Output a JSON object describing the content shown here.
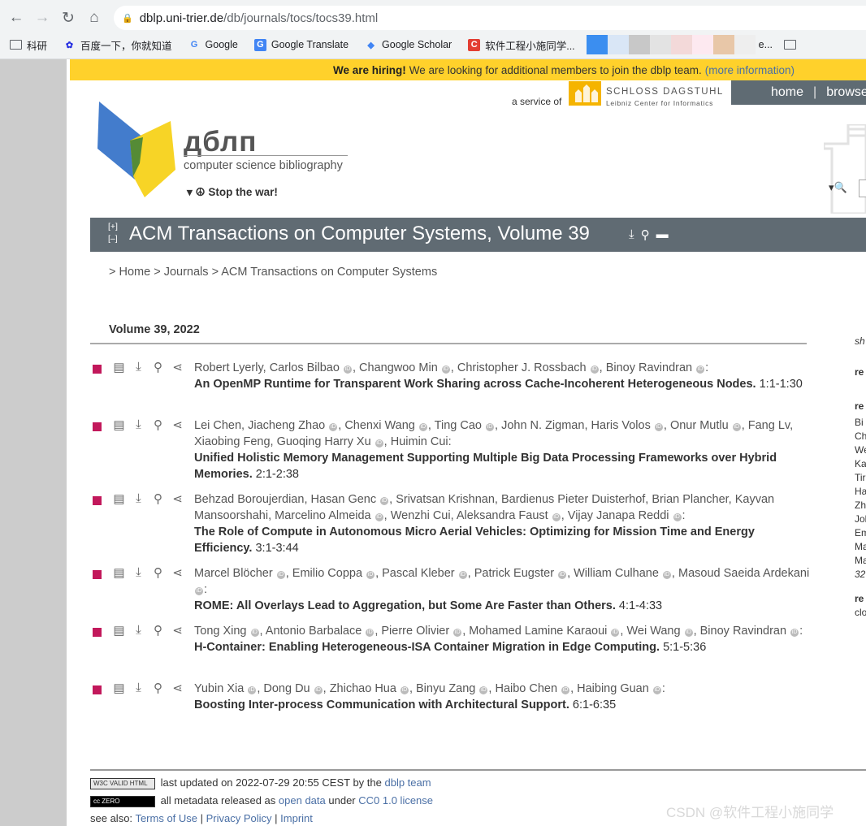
{
  "browser": {
    "url_host": "dblp.uni-trier.de",
    "url_path": "/db/journals/tocs/tocs39.html",
    "bookmarks": [
      "科研",
      "百度一下，你就知道",
      "Google",
      "Google Translate",
      "Google Scholar",
      "软件工程小施同学...",
      "e..."
    ]
  },
  "banner": {
    "bold": "We are hiring!",
    "text": "We are looking for additional members to join the dblp team.",
    "more": "(more information)"
  },
  "header": {
    "service_of": "a service of",
    "dagstuhl_name": "SCHLOSS DAGSTUHL",
    "dagstuhl_sub": "Leibniz Center for Informatics",
    "nav_home": "home",
    "nav_sep": "|",
    "nav_browse": "browse",
    "logo_text": "дблп",
    "logo_sub": "computer science bibliography",
    "stop_war": "Stop the war!"
  },
  "title_bar": {
    "toggle_plus": "[+]",
    "toggle_minus": "[–]",
    "title": "ACM Transactions on Computer Systems, Volume 39"
  },
  "breadcrumb": {
    "p1": ">",
    "home": "Home",
    "p2": ">",
    "journals": "Journals",
    "p3": ">",
    "venue": "ACM Transactions on Computer Systems"
  },
  "volume_heading": "Volume 39, 2022",
  "entries": [
    {
      "authors": [
        "Robert Lyerly",
        "Carlos Bilbao",
        "Changwoo Min",
        "Christopher J. Rossbach",
        "Binoy Ravindran"
      ],
      "title": "An OpenMP Runtime for Transparent Work Sharing across Cache-Incoherent Heterogeneous Nodes.",
      "pages": "1:1-1:30"
    },
    {
      "authors": [
        "Lei Chen",
        "Jiacheng Zhao",
        "Chenxi Wang",
        "Ting Cao",
        "John N. Zigman",
        "Haris Volos",
        "Onur Mutlu",
        "Fang Lv",
        "Xiaobing Feng",
        "Guoqing Harry Xu",
        "Huimin Cui"
      ],
      "title": "Unified Holistic Memory Management Supporting Multiple Big Data Processing Frameworks over Hybrid Memories.",
      "pages": "2:1-2:38"
    },
    {
      "authors": [
        "Behzad Boroujerdian",
        "Hasan Genc",
        "Srivatsan Krishnan",
        "Bardienus Pieter Duisterhof",
        "Brian Plancher",
        "Kayvan Mansoorshahi",
        "Marcelino Almeida",
        "Wenzhi Cui",
        "Aleksandra Faust",
        "Vijay Janapa Reddi"
      ],
      "title": "The Role of Compute in Autonomous Micro Aerial Vehicles: Optimizing for Mission Time and Energy Efficiency.",
      "pages": "3:1-3:44"
    },
    {
      "authors": [
        "Marcel Blöcher",
        "Emilio Coppa",
        "Pascal Kleber",
        "Patrick Eugster",
        "William Culhane",
        "Masoud Saeida Ardekani"
      ],
      "title": "ROME: All Overlays Lead to Aggregation, but Some Are Faster than Others.",
      "pages": "4:1-4:33"
    },
    {
      "authors": [
        "Tong Xing",
        "Antonio Barbalace",
        "Pierre Olivier",
        "Mohamed Lamine Karaoui",
        "Wei Wang",
        "Binoy Ravindran"
      ],
      "title": "H-Container: Enabling Heterogeneous-ISA Container Migration in Edge Computing.",
      "pages": "5:1-5:36"
    },
    {
      "authors": [
        "Yubin Xia",
        "Dong Du",
        "Zhichao Hua",
        "Binyu Zang",
        "Haibo Chen",
        "Haibing Guan"
      ],
      "title": "Boosting Inter-process Communication with Architectural Support.",
      "pages": "6:1-6:35"
    }
  ],
  "right_column": [
    "sh",
    "re",
    "re",
    "Bi",
    "Ch",
    "We",
    "Ka",
    "Tir",
    "Ha",
    "Zh",
    "Joh",
    "Em",
    "Ma",
    "Ma",
    "32",
    "re",
    "clo"
  ],
  "footer": {
    "w3c_badge": "W3C VALID HTML",
    "updated_prefix": "last updated on 2022-07-29 20:55 CEST by the",
    "updated_link": "dblp team",
    "cc_badge": "cc ZERO",
    "meta_prefix": "all metadata released as",
    "open_data": "open data",
    "under": "under",
    "license": "CC0 1.0 license",
    "see_also": "see also:",
    "terms": "Terms of Use",
    "privacy": "Privacy Policy",
    "imprint": "Imprint"
  },
  "watermark": "CSDN @软件工程小施同学"
}
